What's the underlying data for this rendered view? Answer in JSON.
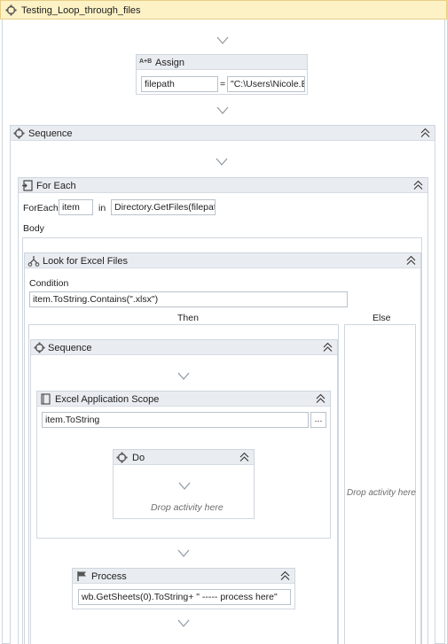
{
  "workflow": {
    "title": "Testing_Loop_through_files"
  },
  "assign": {
    "title": "Assign",
    "to_value": "filepath",
    "equals": "=",
    "value": "\"C:\\Users\\Nicole.Ec"
  },
  "sequence_outer": {
    "title": "Sequence"
  },
  "foreach": {
    "title": "For Each",
    "foreach_label": "ForEach",
    "item_value": "item",
    "in_label": "in",
    "values_value": "Directory.GetFiles(filepath)",
    "body_label": "Body"
  },
  "if_activity": {
    "title": "Look for Excel Files",
    "condition_label": "Condition",
    "condition_value": "item.ToString.Contains(\".xlsx\")",
    "then_label": "Then",
    "else_label": "Else",
    "else_drop": "Drop activity here"
  },
  "sequence_inner": {
    "title": "Sequence"
  },
  "excel_scope": {
    "title": "Excel Application Scope",
    "path_value": "item.ToString",
    "browse_label": "..."
  },
  "do_block": {
    "title": "Do",
    "drop": "Drop activity here"
  },
  "process": {
    "title": "Process",
    "text_value": "wb.GetSheets(0).ToString+ \"   -----   process here\""
  },
  "colors": {
    "header_bar": "#fdf2c5",
    "activity_header": "#e9edf1",
    "border": "#cfd6de"
  }
}
